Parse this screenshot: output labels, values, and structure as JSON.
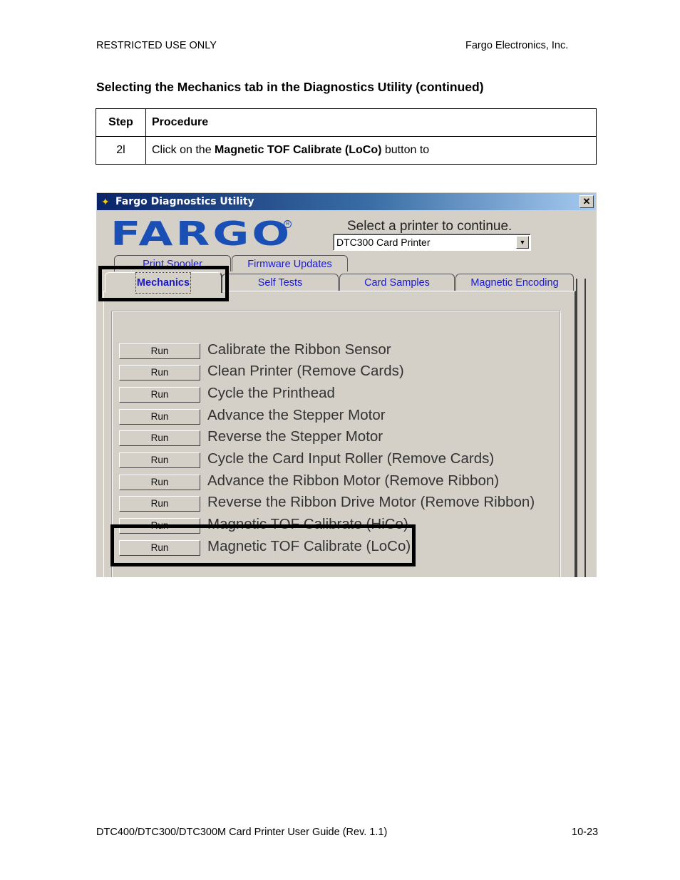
{
  "header": {
    "left": "RESTRICTED USE ONLY",
    "right": "Fargo Electronics, Inc."
  },
  "section_title": "Selecting the Mechanics tab in the Diagnostics Utility (continued)",
  "steps_table": {
    "columns": [
      "Step",
      "Procedure"
    ],
    "rows": [
      {
        "step": "2l",
        "text_before": "Click on the ",
        "text_bold": "Magnetic TOF Calibrate (LoCo)",
        "text_after": " button to"
      }
    ]
  },
  "app": {
    "window_title": "Fargo Diagnostics Utility",
    "close_label": "✕",
    "logo_text": "FARGO",
    "select_prompt": "Select a printer to continue.",
    "selected_printer": "DTC300 Card Printer",
    "dropdown_arrow": "▼",
    "tabs_back_row": [
      "Print Spooler",
      "Firmware Updates"
    ],
    "tabs_front_row": [
      "Mechanics",
      "Self Tests",
      "Card Samples",
      "Magnetic Encoding"
    ],
    "active_tab": "Mechanics",
    "run_label": "Run",
    "actions": [
      "Calibrate the Ribbon Sensor",
      "Clean Printer (Remove Cards)",
      "Cycle the Printhead",
      "Advance the Stepper Motor",
      "Reverse the Stepper Motor",
      "Cycle the Card Input Roller (Remove Cards)",
      "Advance the Ribbon Motor (Remove Ribbon)",
      "Reverse the Ribbon Drive Motor (Remove Ribbon)",
      "Magnetic TOF Calibrate (HiCo)",
      "Magnetic TOF Calibrate (LoCo)"
    ],
    "highlight_color": "#000000",
    "accent_blue": "#1a4fb5",
    "tab_text_color": "#1a1acc"
  },
  "footer": {
    "left": "DTC400/DTC300/DTC300M Card Printer User Guide (Rev. 1.1)",
    "right": "10-23"
  }
}
